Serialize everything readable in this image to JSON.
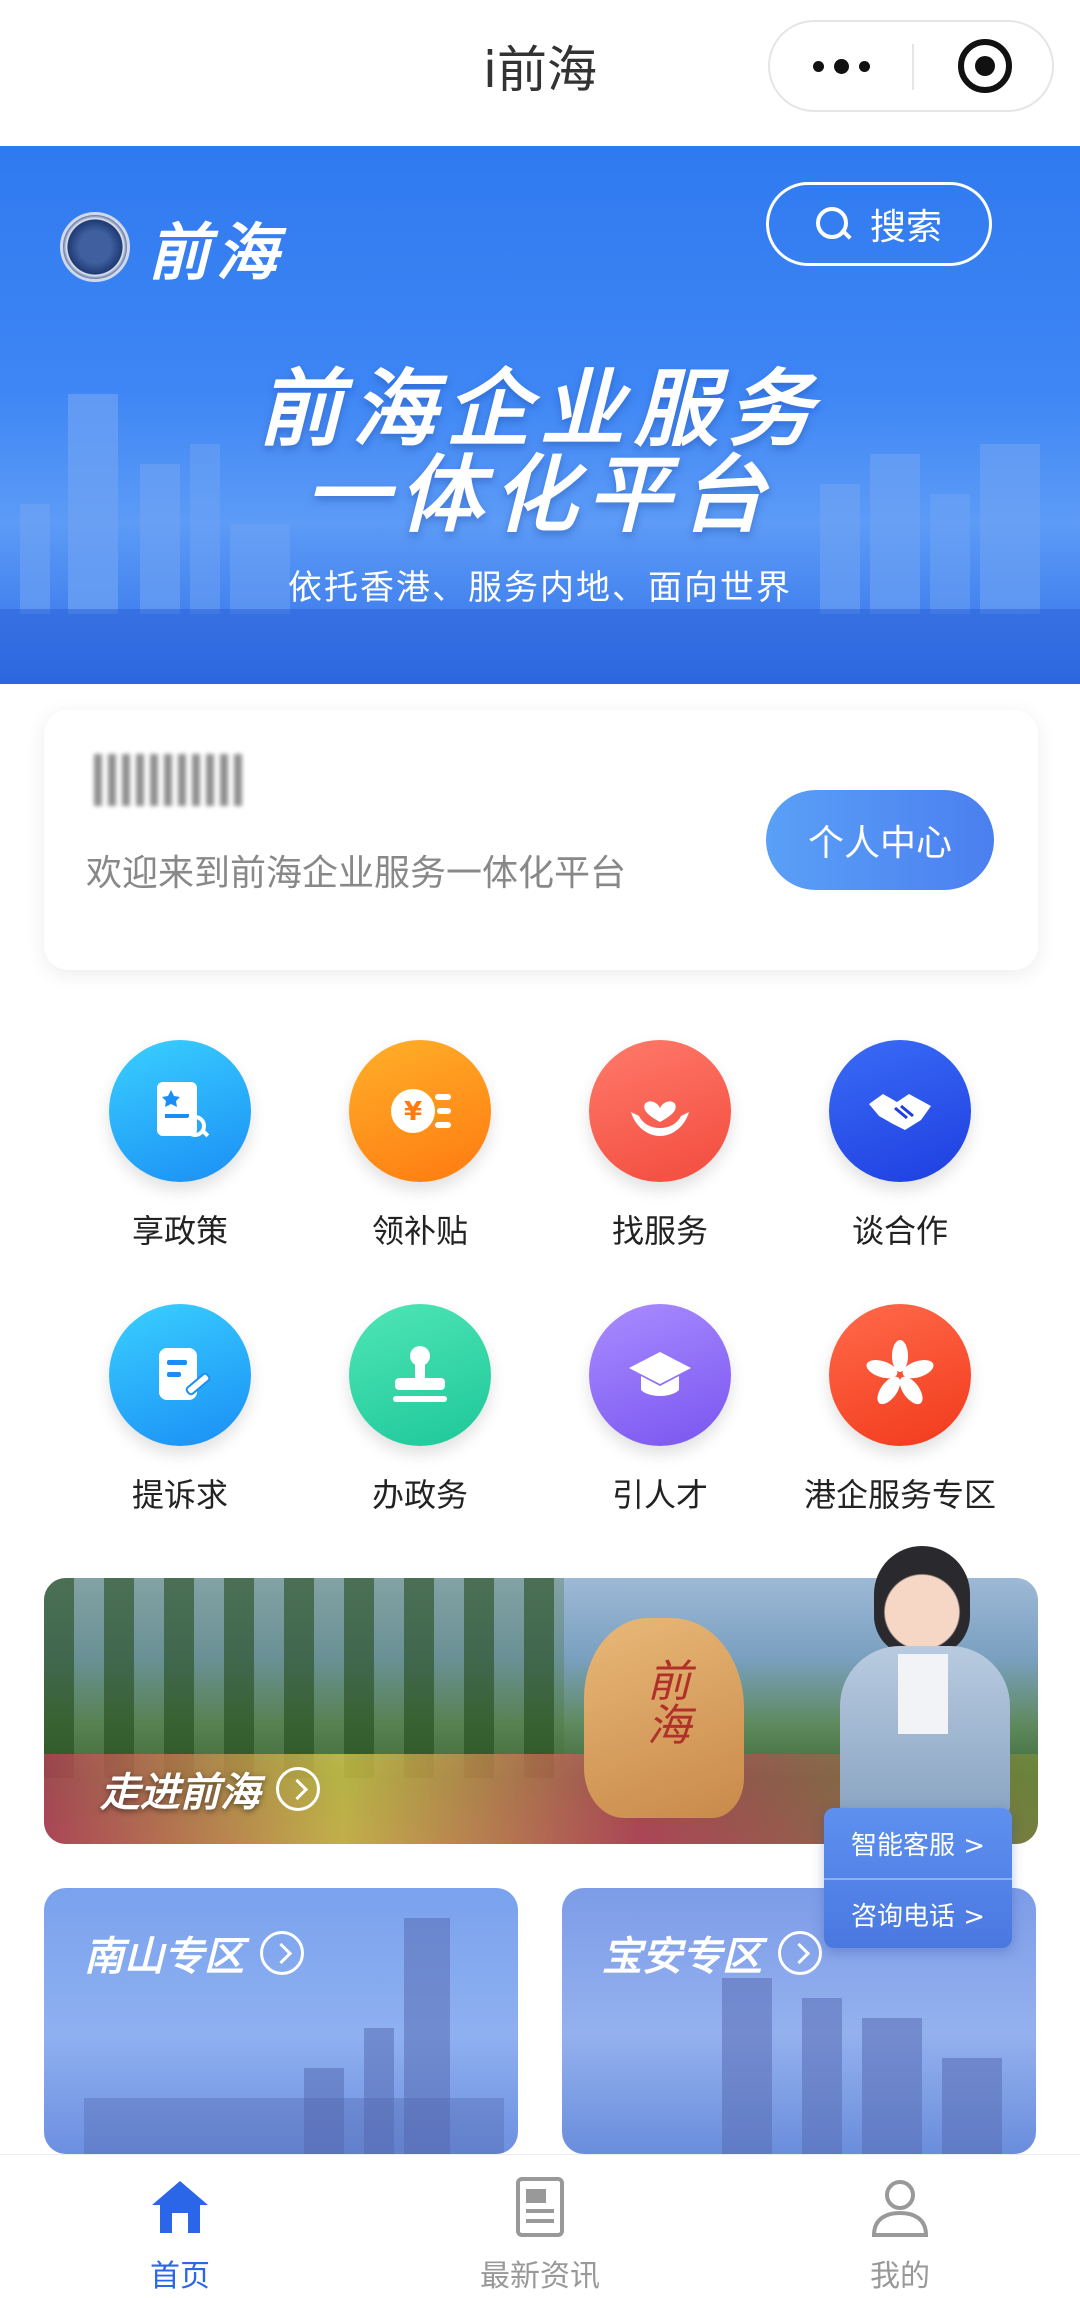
{
  "navbar": {
    "title": "i前海"
  },
  "banner": {
    "logo_text": "前海",
    "search_label": "搜索",
    "title_line1": "前海企业服务",
    "title_line2": "一体化平台",
    "subtitle": "依托香港、服务内地、面向世界"
  },
  "welcome": {
    "message": "欢迎来到前海企业服务一体化平台",
    "personal_center": "个人中心"
  },
  "services": [
    {
      "label": "享政策",
      "icon": "policy-document-icon"
    },
    {
      "label": "领补贴",
      "icon": "subsidy-coin-icon"
    },
    {
      "label": "找服务",
      "icon": "heart-hands-icon"
    },
    {
      "label": "谈合作",
      "icon": "handshake-icon"
    },
    {
      "label": "提诉求",
      "icon": "edit-note-icon"
    },
    {
      "label": "办政务",
      "icon": "stamp-icon"
    },
    {
      "label": "引人才",
      "icon": "graduation-cap-icon"
    },
    {
      "label": "港企服务专区",
      "icon": "bauhinia-icon"
    }
  ],
  "promo": {
    "title": "走进前海",
    "rock_text": "前海"
  },
  "help": {
    "smart_service": "智能客服 >",
    "hotline": "咨询电话 >"
  },
  "zones": {
    "nanshan": "南山专区",
    "baoan": "宝安专区"
  },
  "tabs": [
    {
      "label": "首页",
      "icon": "home-icon",
      "active": true
    },
    {
      "label": "最新资讯",
      "icon": "news-icon",
      "active": false
    },
    {
      "label": "我的",
      "icon": "user-icon",
      "active": false
    }
  ],
  "colors": {
    "accent": "#2c66e8",
    "banner": "#3e86f5"
  }
}
